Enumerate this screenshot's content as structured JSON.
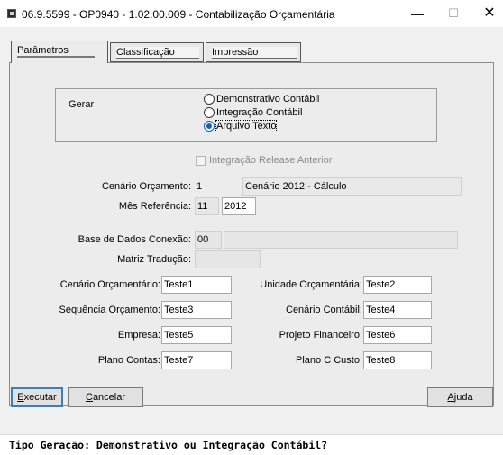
{
  "window": {
    "title": "06.9.5599 - OP0940 - 1.02.00.009 - Contabilização Orçamentária",
    "minimize": "—",
    "maximize": "☐",
    "close": "✕"
  },
  "tabs": [
    {
      "label": "Parâmetros",
      "active": true
    },
    {
      "label": "Classificação",
      "active": false
    },
    {
      "label": "Impressão",
      "active": false
    }
  ],
  "gerar": {
    "label": "Gerar",
    "options": [
      {
        "label": "Demonstrativo Contábil",
        "checked": false
      },
      {
        "label": "Integração Contábil",
        "checked": false
      },
      {
        "label": "Arquivo Texto",
        "checked": true
      }
    ]
  },
  "integracao_release": {
    "label": "Integração Release Anterior",
    "checked": false,
    "enabled": false
  },
  "cenario_orcamento": {
    "label": "Cenário Orçamento:",
    "code": "1",
    "description": "Cenário 2012 - Cálculo"
  },
  "mes_referencia": {
    "label": "Mês Referência:",
    "month": "11",
    "year": "2012"
  },
  "base_dados": {
    "label": "Base de Dados Conexão:",
    "code": "00",
    "description": ""
  },
  "matriz_traducao": {
    "label": "Matriz Tradução:",
    "value": ""
  },
  "form": {
    "cenario_orcamentario": {
      "label": "Cenário Orçamentário:",
      "value": "Teste1"
    },
    "unidade_orcamentaria": {
      "label": "Unidade Orçamentária:",
      "value": "Teste2"
    },
    "sequencia_orcamento": {
      "label": "Sequência Orçamento:",
      "value": "Teste3"
    },
    "cenario_contabil": {
      "label": "Cenário Contábil:",
      "value": "Teste4"
    },
    "empresa": {
      "label": "Empresa:",
      "value": "Teste5"
    },
    "projeto_financeiro": {
      "label": "Projeto Financeiro:",
      "value": "Teste6"
    },
    "plano_contas": {
      "label": "Plano Contas:",
      "value": "Teste7"
    },
    "plano_c_custo": {
      "label": "Plano C Custo:",
      "value": "Teste8"
    }
  },
  "buttons": {
    "executar": {
      "mnemonic": "E",
      "rest": "xecutar"
    },
    "cancelar": {
      "mnemonic": "C",
      "rest": "ancelar"
    },
    "ajuda": {
      "mnemonic": "A",
      "rest": "juda"
    }
  },
  "status_text": "Tipo Geração: Demonstrativo ou Integração Contábil?"
}
